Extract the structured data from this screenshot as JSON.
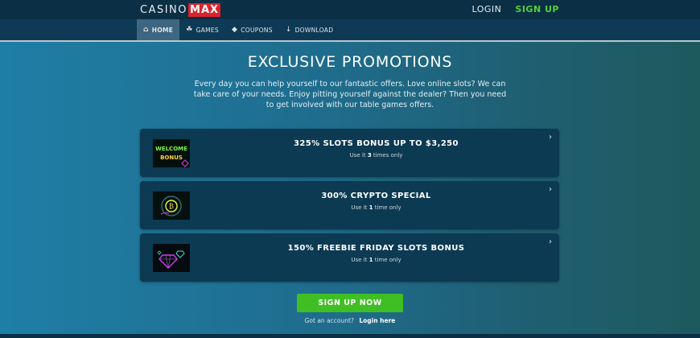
{
  "header": {
    "logo": {
      "casino": "CASINO",
      "max": "MAX"
    },
    "login": "LOGIN",
    "signup": "SIGN UP"
  },
  "nav": {
    "items": [
      {
        "label": "HOME",
        "icon": "home-icon",
        "active": true
      },
      {
        "label": "GAMES",
        "icon": "games-icon",
        "active": false
      },
      {
        "label": "COUPONS",
        "icon": "coupon-icon",
        "active": false
      },
      {
        "label": "DOWNLOAD",
        "icon": "download-icon",
        "active": false
      }
    ]
  },
  "hero": {
    "title": "EXCLUSIVE PROMOTIONS",
    "intro": "Every day you can help yourself to our fantastic offers. Love online slots? We can take care of your needs. Enjoy pitting yourself against the dealer? Then you need to get involved with our table games offers."
  },
  "promos": [
    {
      "title": "325% SLOTS BONUS UP TO $3,250",
      "use_prefix": "Use it",
      "times": "3",
      "use_suffix": "times only",
      "image": "welcome-bonus-neon",
      "image_text": [
        "WELCOME",
        "BONUS"
      ]
    },
    {
      "title": "300% CRYPTO SPECIAL",
      "use_prefix": "Use it",
      "times": "1",
      "use_suffix": "time only",
      "image": "crypto-coin-neon"
    },
    {
      "title": "150% FREEBIE FRIDAY SLOTS BONUS",
      "use_prefix": "Use it",
      "times": "1",
      "use_suffix": "time only",
      "image": "diamonds-neon"
    }
  ],
  "cta": {
    "button": "SIGN UP NOW",
    "account_text": "Got an account?",
    "login_link": "Login here"
  },
  "colors": {
    "accent_green": "#3fbf24",
    "brand_red": "#d9242d",
    "card_bg": "#0c3a52"
  }
}
